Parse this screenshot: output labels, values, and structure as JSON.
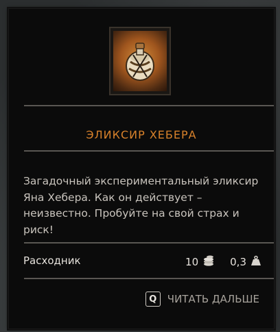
{
  "item": {
    "title": "ЭЛИКСИР ХЕБЕРА",
    "icon": "potion-flask-icon",
    "description": "Загадочный экспериментальный эликсир Яна Хебера. Как он действует – неизвестно. Пробуйте на свой страх и риск!",
    "type_label": "Расходник",
    "price": "10",
    "price_icon": "coins-icon",
    "weight": "0,3",
    "weight_icon": "weight-icon"
  },
  "footer": {
    "key": "Q",
    "action_label": "ЧИТАТЬ ДАЛЬШЕ"
  },
  "colors": {
    "title": "#d9822b",
    "panel_bg": "#0b0b0b",
    "text": "#c9c4bd"
  }
}
